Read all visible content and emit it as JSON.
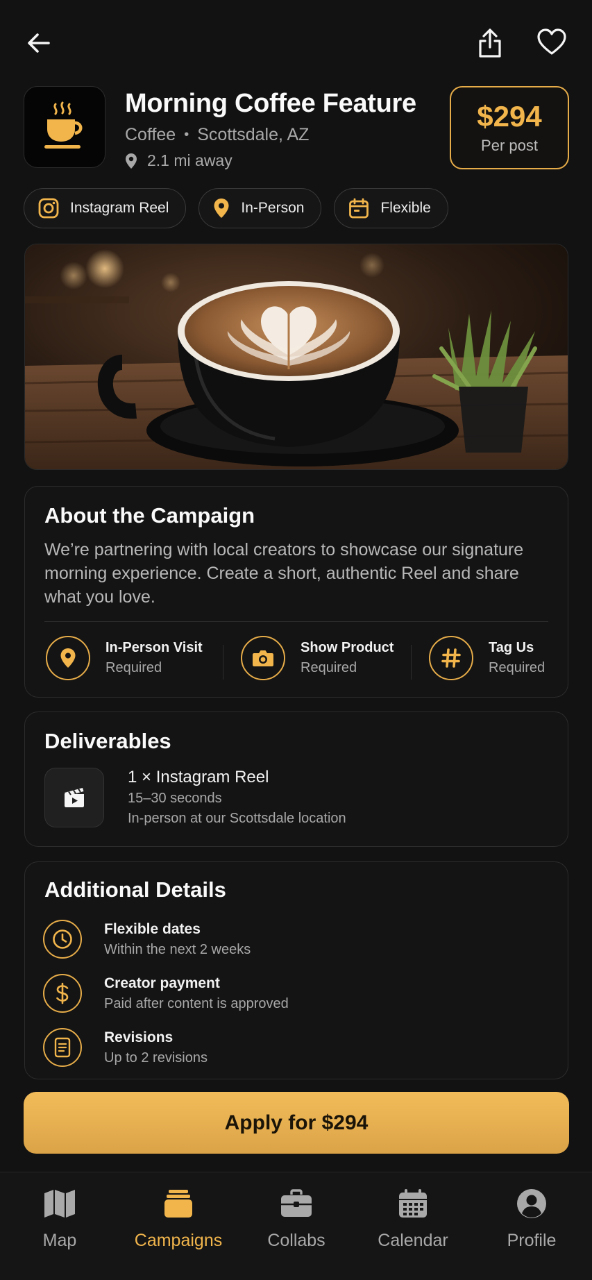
{
  "top_bar": {
    "back_icon": "arrow-left-icon",
    "share_icon": "share-icon",
    "favorite_icon": "heart-icon"
  },
  "header": {
    "logo_icon": "coffee-cup-icon",
    "title": "Morning Coffee Feature",
    "category": "Coffee",
    "separator": "•",
    "location": "Scottsdale, AZ",
    "distance": "2.1 mi away",
    "price": "$294",
    "price_unit": "Per post"
  },
  "chips": [
    {
      "label": "Instagram Reel",
      "icon": "instagram-icon"
    },
    {
      "label": "In-Person",
      "icon": "location-pin-icon"
    },
    {
      "label": "Flexible",
      "icon": "calendar-icon"
    }
  ],
  "hero_image": {
    "subject": "latte-art-coffee-cup"
  },
  "about": {
    "title": "About the Campaign",
    "description": "We’re partnering with local creators to showcase our signature morning experience. Create a short, authentic Reel and share what you love.",
    "requirements": [
      {
        "label": "In-Person Visit",
        "status": "Required",
        "icon": "location-pin-icon"
      },
      {
        "label": "Show Product",
        "status": "Required",
        "icon": "camera-icon"
      },
      {
        "label": "Tag Us",
        "status": "Required",
        "icon": "hashtag-icon"
      }
    ]
  },
  "deliverables": {
    "title": "Deliverables",
    "item": {
      "title": "1 × Instagram Reel",
      "duration": "15–30 seconds",
      "note": "In-person at our Scottsdale location",
      "icon": "clapperboard-icon"
    }
  },
  "additional": {
    "title": "Additional Details",
    "items": [
      {
        "label": "Flexible dates",
        "sub": "Within the next 2 weeks",
        "icon": "clock-icon"
      },
      {
        "label": "Creator payment",
        "sub": "Paid after content is approved",
        "icon": "dollar-icon"
      },
      {
        "label": "Revisions",
        "sub": "Up to 2 revisions",
        "icon": "document-icon"
      }
    ]
  },
  "apply_button": {
    "label": "Apply for $294"
  },
  "tab_bar": {
    "active": "Campaigns",
    "tabs": [
      {
        "label": "Map",
        "icon": "map-icon"
      },
      {
        "label": "Campaigns",
        "icon": "campaigns-icon"
      },
      {
        "label": "Collabs",
        "icon": "briefcase-icon"
      },
      {
        "label": "Calendar",
        "icon": "calendar-icon"
      },
      {
        "label": "Profile",
        "icon": "profile-icon"
      }
    ]
  },
  "colors": {
    "background": "#121212",
    "accent": "#f1b54c",
    "card": "#141414",
    "muted_text": "#a8a8a8"
  }
}
